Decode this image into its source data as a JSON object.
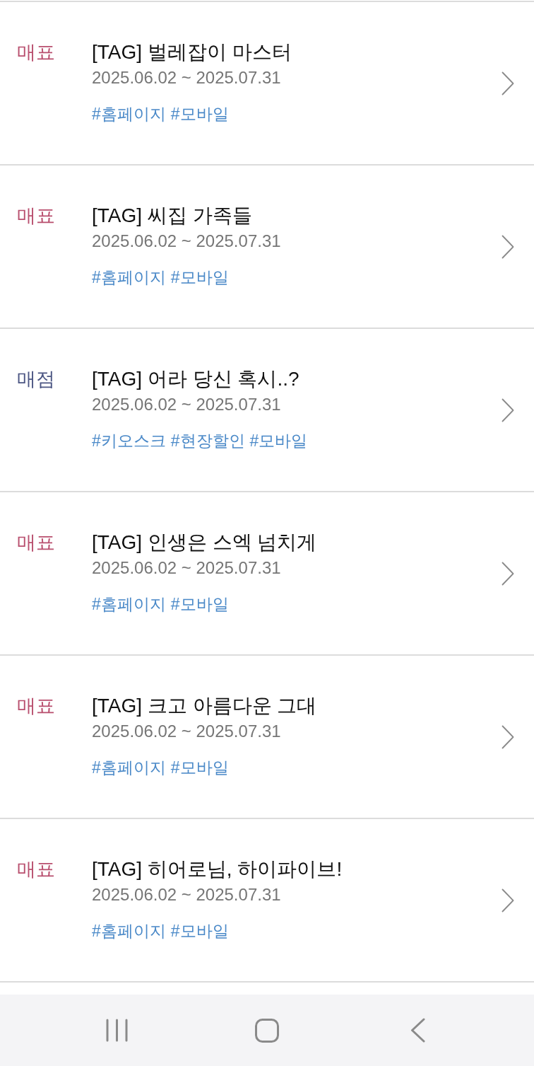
{
  "events": [
    {
      "category": {
        "label": "매표",
        "color": "#b9506f"
      },
      "title": "[TAG] 벌레잡이 마스터",
      "period": "2025.06.02 ~ 2025.07.31",
      "tags": [
        "#홈페이지",
        "#모바일"
      ]
    },
    {
      "category": {
        "label": "매표",
        "color": "#b9506f"
      },
      "title": "[TAG] 씨집 가족들",
      "period": "2025.06.02 ~ 2025.07.31",
      "tags": [
        "#홈페이지",
        "#모바일"
      ]
    },
    {
      "category": {
        "label": "매점",
        "color": "#4c5683"
      },
      "title": "[TAG] 어라 당신 혹시..?",
      "period": "2025.06.02 ~ 2025.07.31",
      "tags": [
        "#키오스크",
        "#현장할인",
        "#모바일"
      ]
    },
    {
      "category": {
        "label": "매표",
        "color": "#b9506f"
      },
      "title": "[TAG] 인생은 스엑 넘치게",
      "period": "2025.06.02 ~ 2025.07.31",
      "tags": [
        "#홈페이지",
        "#모바일"
      ]
    },
    {
      "category": {
        "label": "매표",
        "color": "#b9506f"
      },
      "title": "[TAG] 크고 아름다운 그대",
      "period": "2025.06.02 ~ 2025.07.31",
      "tags": [
        "#홈페이지",
        "#모바일"
      ]
    },
    {
      "category": {
        "label": "매표",
        "color": "#b9506f"
      },
      "title": "[TAG] 히어로님, 하이파이브!",
      "period": "2025.06.02 ~ 2025.07.31",
      "tags": [
        "#홈페이지",
        "#모바일"
      ]
    }
  ]
}
